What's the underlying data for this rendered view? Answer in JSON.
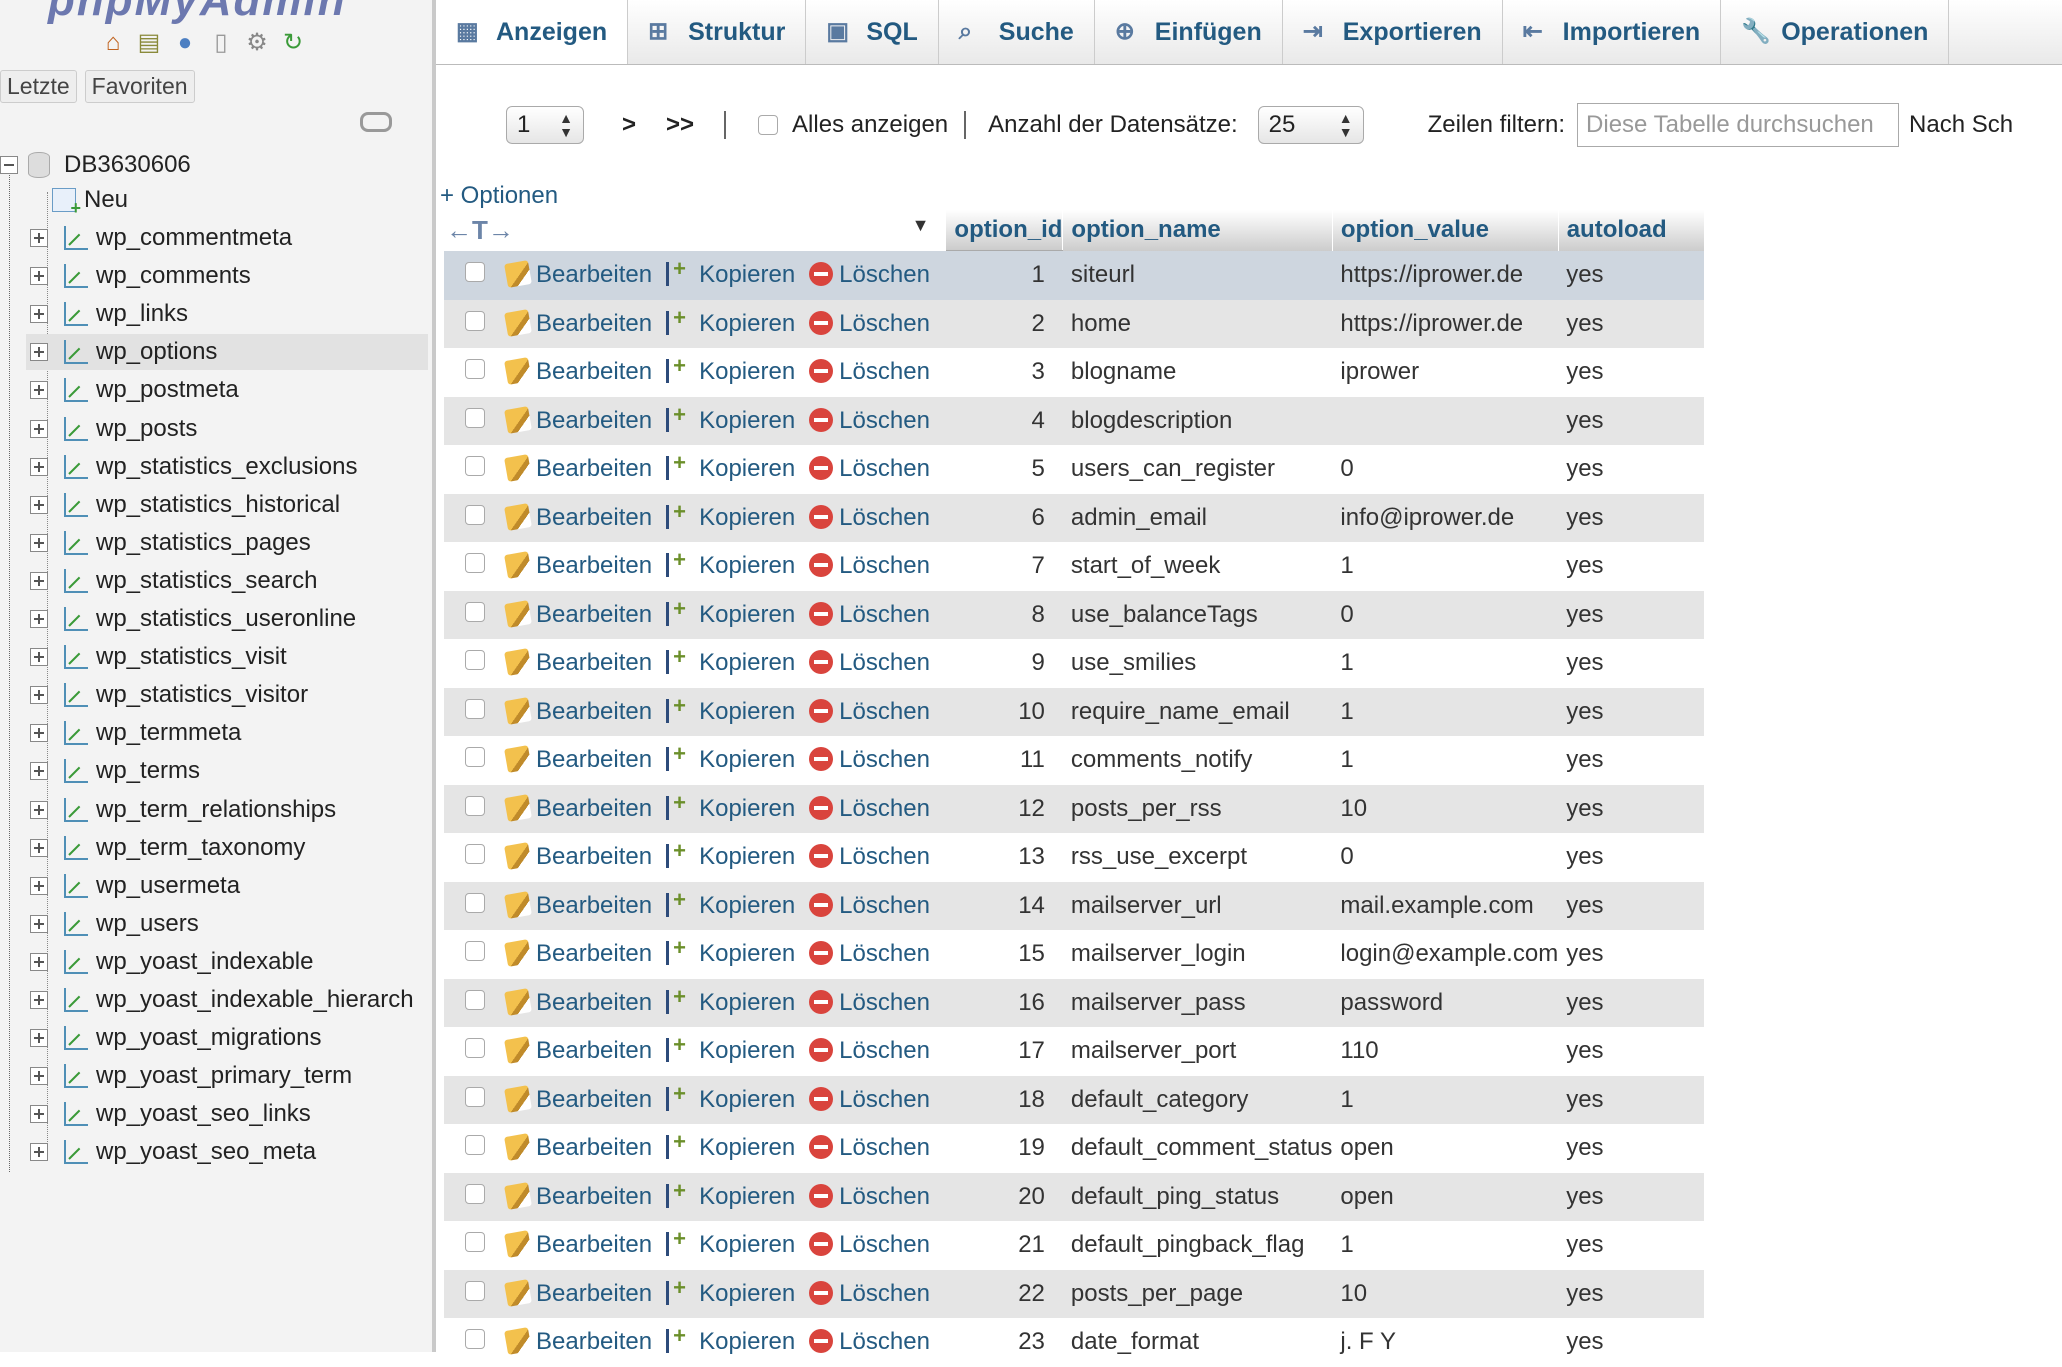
{
  "logo": "phpMyAdmin",
  "nav": {
    "recent_tab": "Letzte",
    "favorites_tab": "Favoriten",
    "icons": [
      "home-icon",
      "database-icon",
      "help-icon",
      "docs-icon",
      "settings-icon",
      "reload-icon"
    ],
    "database": "DB3630606",
    "new_label": "Neu",
    "tables": [
      "wp_commentmeta",
      "wp_comments",
      "wp_links",
      "wp_options",
      "wp_postmeta",
      "wp_posts",
      "wp_statistics_exclusions",
      "wp_statistics_historical",
      "wp_statistics_pages",
      "wp_statistics_search",
      "wp_statistics_useronline",
      "wp_statistics_visit",
      "wp_statistics_visitor",
      "wp_termmeta",
      "wp_terms",
      "wp_term_relationships",
      "wp_term_taxonomy",
      "wp_usermeta",
      "wp_users",
      "wp_yoast_indexable",
      "wp_yoast_indexable_hierarch",
      "wp_yoast_migrations",
      "wp_yoast_primary_term",
      "wp_yoast_seo_links",
      "wp_yoast_seo_meta"
    ],
    "active_table": "wp_options"
  },
  "tabs": [
    {
      "label": "Anzeigen",
      "icon": "browse-icon",
      "active": true
    },
    {
      "label": "Struktur",
      "icon": "structure-icon"
    },
    {
      "label": "SQL",
      "icon": "sql-icon"
    },
    {
      "label": "Suche",
      "icon": "search-icon"
    },
    {
      "label": "Einfügen",
      "icon": "insert-icon"
    },
    {
      "label": "Exportieren",
      "icon": "export-icon"
    },
    {
      "label": "Importieren",
      "icon": "import-icon"
    },
    {
      "label": "Operationen",
      "icon": "operations-icon"
    }
  ],
  "pager": {
    "page": "1",
    "next": ">",
    "last": ">>",
    "show_all": "Alles anzeigen",
    "rows_label": "Anzahl der Datensätze:",
    "rows_value": "25",
    "filter_label": "Zeilen filtern:",
    "filter_placeholder": "Diese Tabelle durchsuchen",
    "sort_label": "Nach Sch"
  },
  "options_link": "+ Optionen",
  "columns": [
    "option_id",
    "option_name",
    "option_value",
    "autoload"
  ],
  "actions": {
    "edit": "Bearbeiten",
    "copy": "Kopieren",
    "delete": "Löschen"
  },
  "rows": [
    [
      "1",
      "siteurl",
      "https://iprower.de",
      "yes"
    ],
    [
      "2",
      "home",
      "https://iprower.de",
      "yes"
    ],
    [
      "3",
      "blogname",
      "iprower",
      "yes"
    ],
    [
      "4",
      "blogdescription",
      "",
      "yes"
    ],
    [
      "5",
      "users_can_register",
      "0",
      "yes"
    ],
    [
      "6",
      "admin_email",
      "info@iprower.de",
      "yes"
    ],
    [
      "7",
      "start_of_week",
      "1",
      "yes"
    ],
    [
      "8",
      "use_balanceTags",
      "0",
      "yes"
    ],
    [
      "9",
      "use_smilies",
      "1",
      "yes"
    ],
    [
      "10",
      "require_name_email",
      "1",
      "yes"
    ],
    [
      "11",
      "comments_notify",
      "1",
      "yes"
    ],
    [
      "12",
      "posts_per_rss",
      "10",
      "yes"
    ],
    [
      "13",
      "rss_use_excerpt",
      "0",
      "yes"
    ],
    [
      "14",
      "mailserver_url",
      "mail.example.com",
      "yes"
    ],
    [
      "15",
      "mailserver_login",
      "login@example.com",
      "yes"
    ],
    [
      "16",
      "mailserver_pass",
      "password",
      "yes"
    ],
    [
      "17",
      "mailserver_port",
      "110",
      "yes"
    ],
    [
      "18",
      "default_category",
      "1",
      "yes"
    ],
    [
      "19",
      "default_comment_status",
      "open",
      "yes"
    ],
    [
      "20",
      "default_ping_status",
      "open",
      "yes"
    ],
    [
      "21",
      "default_pingback_flag",
      "1",
      "yes"
    ],
    [
      "22",
      "posts_per_page",
      "10",
      "yes"
    ],
    [
      "23",
      "date_format",
      "j. F Y",
      "yes"
    ]
  ]
}
